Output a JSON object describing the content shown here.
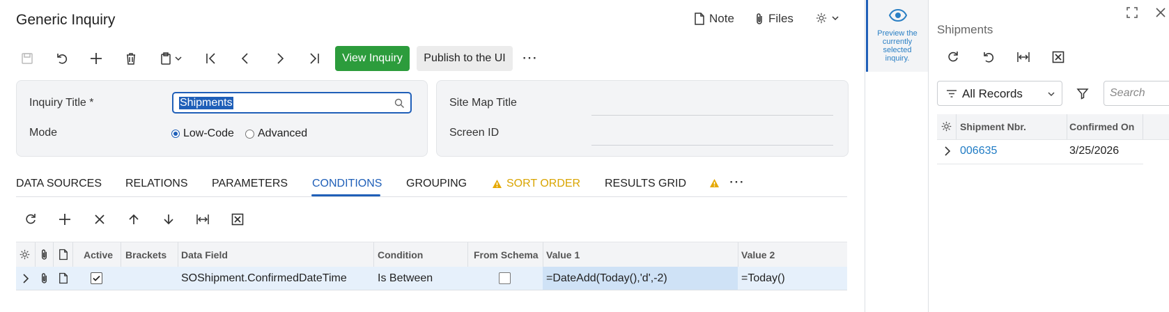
{
  "header": {
    "title": "Generic Inquiry",
    "note_label": "Note",
    "files_label": "Files"
  },
  "toolbar": {
    "view_inquiry_label": "View Inquiry",
    "publish_label": "Publish to the UI",
    "more_label": "⋯"
  },
  "form": {
    "inquiry_title_label": "Inquiry Title *",
    "inquiry_title_value": "Shipments",
    "mode_label": "Mode",
    "mode_options": [
      "Low-Code",
      "Advanced"
    ],
    "mode_selected": "Low-Code",
    "site_map_title_label": "Site Map Title",
    "site_map_title_value": "",
    "screen_id_label": "Screen ID",
    "screen_id_value": ""
  },
  "tabs": [
    {
      "label": "DATA SOURCES"
    },
    {
      "label": "RELATIONS"
    },
    {
      "label": "PARAMETERS"
    },
    {
      "label": "CONDITIONS"
    },
    {
      "label": "GROUPING"
    },
    {
      "label": "SORT ORDER"
    },
    {
      "label": "RESULTS GRID"
    }
  ],
  "active_tab": "CONDITIONS",
  "conditions_grid": {
    "columns": [
      "Active",
      "Brackets",
      "Data Field",
      "Condition",
      "From Schema",
      "Value 1",
      "Value 2"
    ],
    "rows": [
      {
        "active": true,
        "brackets": "",
        "data_field": "SOShipment.ConfirmedDateTime",
        "condition": "Is Between",
        "from_schema": false,
        "value1": "=DateAdd(Today(),'d',-2)",
        "value2": "=Today()"
      }
    ]
  },
  "preview_strip": {
    "label": "Preview the currently selected inquiry."
  },
  "right_panel": {
    "title": "Shipments",
    "filter_label": "All Records",
    "search_placeholder": "Search",
    "columns": [
      "Shipment Nbr.",
      "Confirmed On"
    ],
    "rows": [
      {
        "shipment_nbr": "006635",
        "confirmed_on": "3/25/2026"
      }
    ]
  },
  "colors": {
    "accent": "#1f5fb8",
    "primary_button": "#2c9c3c",
    "warning": "#d9a400",
    "link": "#1f7bc4"
  }
}
